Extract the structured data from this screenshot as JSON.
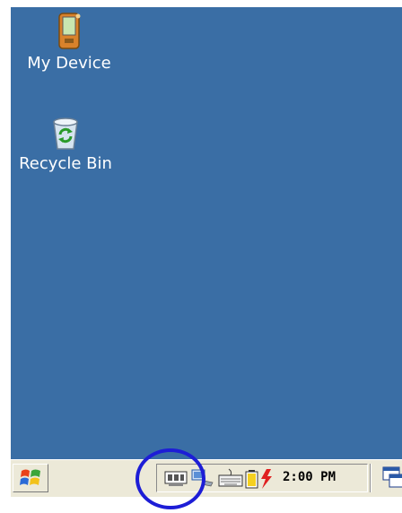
{
  "desktop": {
    "background_color": "#3a6ea5",
    "icons": [
      {
        "label": "My Device",
        "icon": "handheld-device-icon"
      },
      {
        "label": "Recycle Bin",
        "icon": "recycle-bin-icon"
      }
    ]
  },
  "taskbar": {
    "start_icon": "windows-logo-icon",
    "tray_icons": [
      "network-card-icon",
      "pc-connection-icon",
      "keyboard-icon",
      "battery-charging-icon"
    ],
    "clock": "2:00 PM",
    "show_desktop_icon": "show-desktop-icon"
  },
  "annotation": {
    "color": "#1d1dd6",
    "target": "network-card-icon"
  }
}
